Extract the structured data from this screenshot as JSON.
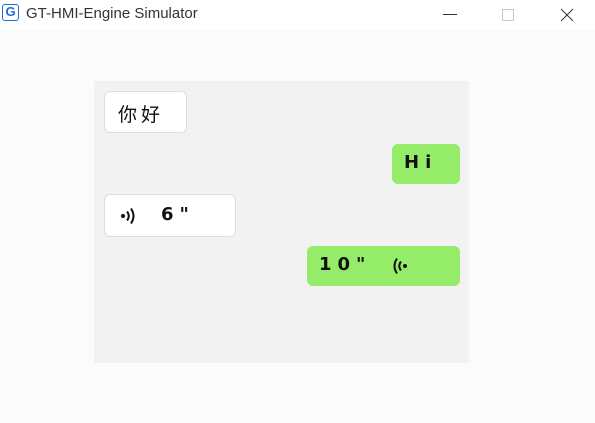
{
  "window": {
    "title": "GT-HMI-Engine Simulator",
    "icon_letter": "G",
    "icon": "app-logo-icon",
    "buttons": [
      "minimize-icon",
      "maximize-icon",
      "close-icon"
    ]
  },
  "chat": {
    "messages": [
      {
        "side": "left",
        "type": "text",
        "text": "你好"
      },
      {
        "side": "right",
        "type": "text",
        "text": "Hi"
      },
      {
        "side": "left",
        "type": "voice",
        "duration": "6\"",
        "icon": "voice-wave-icon"
      },
      {
        "side": "right",
        "type": "voice",
        "duration": "10\"",
        "icon": "voice-wave-icon"
      }
    ],
    "colors": {
      "panel": "#f2f2f2",
      "left_bubble": "#ffffff",
      "right_bubble": "#95ec69"
    }
  }
}
